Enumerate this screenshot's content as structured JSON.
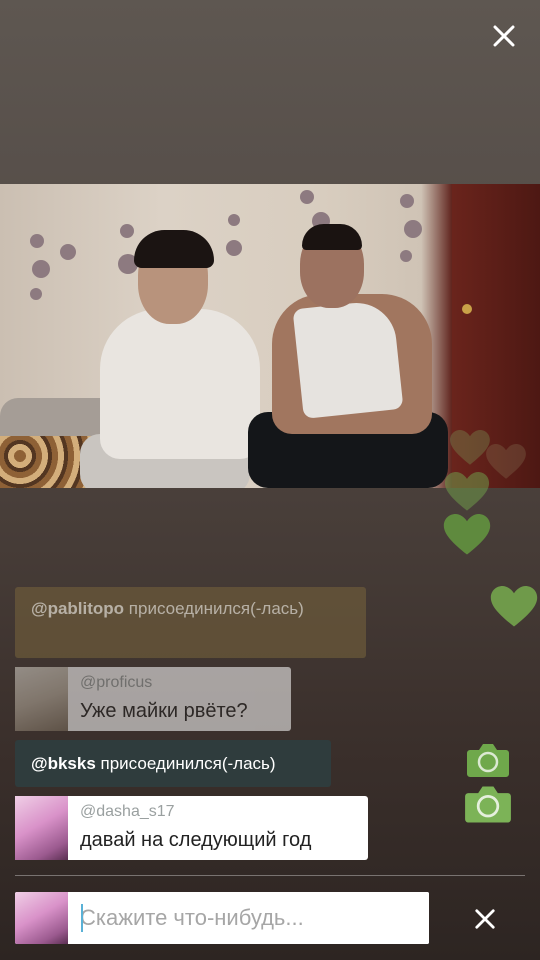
{
  "header": {
    "close_icon": "close-icon"
  },
  "stream": {
    "description_icon": "live-video"
  },
  "comments": [
    {
      "type": "join",
      "user": "@pablitopo",
      "text": "присоединился(-лась)"
    },
    {
      "type": "message",
      "user": "@proficus",
      "text": "Уже майки рвёте?"
    },
    {
      "type": "join",
      "user": "@bksks",
      "text": "присоединился(-лась)"
    },
    {
      "type": "message",
      "user": "@dasha_s17",
      "text": "давай на следующий год"
    }
  ],
  "composer": {
    "placeholder": "Скажите что-нибудь...",
    "value": ""
  },
  "colors": {
    "heart": "#6f9a4a",
    "heart_faded": "#7a9a58",
    "camera": "#6fa84b",
    "join_bg_dark": "#2f3c3d"
  }
}
